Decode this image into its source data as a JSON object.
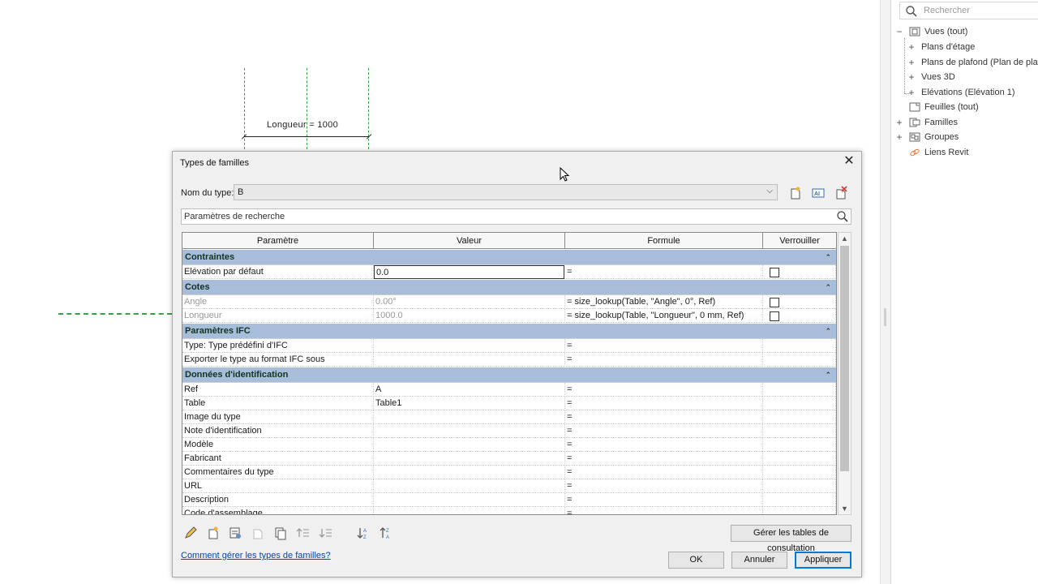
{
  "canvas": {
    "dimension_label": "Longueur = 1000"
  },
  "project_browser": {
    "search_placeholder": "Rechercher",
    "items": [
      {
        "label": "Vues (tout)",
        "expander": "−"
      },
      {
        "label": "Plans d'étage",
        "expander": "+"
      },
      {
        "label": "Plans de plafond (Plan de plafond)",
        "expander": "+"
      },
      {
        "label": "Vues 3D",
        "expander": "+"
      },
      {
        "label": "Elévations (Elévation 1)",
        "expander": "+"
      },
      {
        "label": "Feuilles (tout)",
        "expander": ""
      },
      {
        "label": "Familles",
        "expander": "+"
      },
      {
        "label": "Groupes",
        "expander": "+"
      },
      {
        "label": "Liens Revit",
        "expander": ""
      }
    ]
  },
  "dialog": {
    "title": "Types de familles",
    "type_name_label": "Nom du type:",
    "type_name_value": "B",
    "search_placeholder": "Paramètres de recherche",
    "columns": [
      "Paramètre",
      "Valeur",
      "Formule",
      "Verrouiller"
    ],
    "groups": [
      {
        "name": "Contraintes",
        "rows": [
          {
            "param": "Elévation par défaut",
            "value": "0.0",
            "formula": "=",
            "lock": true,
            "editing": true
          }
        ]
      },
      {
        "name": "Cotes",
        "rows": [
          {
            "param": "Angle",
            "value": "0.00°",
            "formula": "= size_lookup(Table, \"Angle\", 0°, Ref)",
            "lock": true,
            "dim": true
          },
          {
            "param": "Longueur",
            "value": "1000.0",
            "formula": "= size_lookup(Table, \"Longueur\", 0 mm, Ref)",
            "lock": true,
            "dim": true
          }
        ]
      },
      {
        "name": "Paramètres IFC",
        "rows": [
          {
            "param": "Type: Type prédéfini d'IFC",
            "value": "",
            "formula": "=",
            "lock": false
          },
          {
            "param": "Exporter le type au format IFC sous",
            "value": "",
            "formula": "=",
            "lock": false
          }
        ]
      },
      {
        "name": "Données d'identification",
        "rows": [
          {
            "param": "Ref",
            "value": "A",
            "formula": "=",
            "lock": false
          },
          {
            "param": "Table",
            "value": "Table1",
            "formula": "=",
            "lock": false
          },
          {
            "param": "Image du type",
            "value": "",
            "formula": "=",
            "lock": false
          },
          {
            "param": "Note d'identification",
            "value": "",
            "formula": "=",
            "lock": false
          },
          {
            "param": "Modèle",
            "value": "",
            "formula": "=",
            "lock": false
          },
          {
            "param": "Fabricant",
            "value": "",
            "formula": "=",
            "lock": false
          },
          {
            "param": "Commentaires du type",
            "value": "",
            "formula": "=",
            "lock": false
          },
          {
            "param": "URL",
            "value": "",
            "formula": "=",
            "lock": false
          },
          {
            "param": "Description",
            "value": "",
            "formula": "=",
            "lock": false
          },
          {
            "param": "Code d'assemblage",
            "value": "",
            "formula": "=",
            "lock": false
          }
        ]
      }
    ],
    "manage_tables_label": "Gérer les tables de consultation",
    "help_link": "Comment gérer les types de familles?",
    "ok_label": "OK",
    "cancel_label": "Annuler",
    "apply_label": "Appliquer"
  },
  "colors": {
    "group_header": "#a8bdd9",
    "link": "#0645ad",
    "dashed_reference": "#3aa046",
    "apply_border": "#0078d7"
  }
}
